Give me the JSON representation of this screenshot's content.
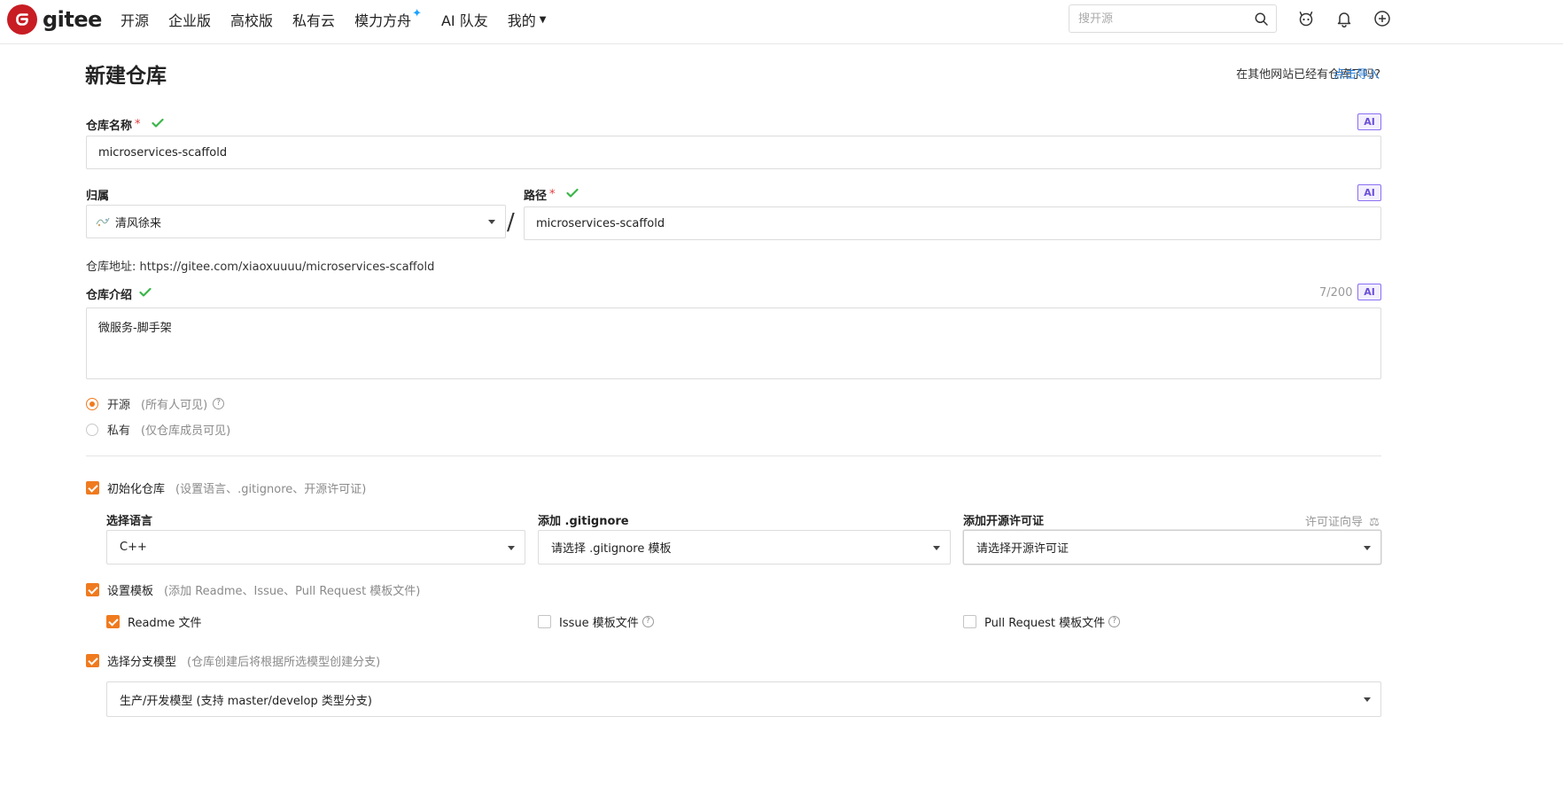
{
  "nav": {
    "brand": "gitee",
    "items": [
      "开源",
      "企业版",
      "高校版",
      "私有云",
      "模力方舟",
      "AI 队友",
      "我的"
    ],
    "search_placeholder": "搜开源"
  },
  "header": {
    "title": "新建仓库",
    "import_hint": "在其他网站已经有仓库了吗?",
    "import_link": "点击导入"
  },
  "form": {
    "repo_name_label": "仓库名称",
    "repo_name_value": "microservices-scaffold",
    "required_mark": "*",
    "ai_badge": "AI",
    "owner_label": "归属",
    "owner_value": "清风徐来",
    "path_label": "路径",
    "path_value": "microservices-scaffold",
    "slash": "/",
    "repo_url": "仓库地址: https://gitee.com/xiaoxuuuu/microservices-scaffold",
    "desc_label": "仓库介绍",
    "desc_counter": "7/200",
    "desc_value": "微服务-脚手架",
    "visibility": {
      "public_label": "开源",
      "public_hint": "(所有人可见)",
      "private_label": "私有",
      "private_hint": "(仅仓库成员可见)",
      "selected": "public"
    },
    "init_repo": {
      "label": "初始化仓库",
      "hint": "(设置语言、.gitignore、开源许可证)",
      "checked": true,
      "language_label": "选择语言",
      "language_value": "C++",
      "gitignore_label": "添加 .gitignore",
      "gitignore_value": "请选择 .gitignore 模板",
      "license_label": "添加开源许可证",
      "license_value": "请选择开源许可证",
      "license_guide": "许可证向导"
    },
    "templates": {
      "label": "设置模板",
      "hint": "(添加 Readme、Issue、Pull Request 模板文件)",
      "checked": true,
      "readme_label": "Readme 文件",
      "readme_checked": true,
      "issue_label": "Issue 模板文件",
      "issue_checked": false,
      "pr_label": "Pull Request 模板文件",
      "pr_checked": false
    },
    "branch_model": {
      "label": "选择分支模型",
      "hint": "(仓库创建后将根据所选模型创建分支)",
      "checked": true,
      "value": "生产/开发模型 (支持 master/develop 类型分支)"
    }
  },
  "colors": {
    "brand_red": "#c71d23",
    "accent_orange": "#f07a1e",
    "link_blue": "#2b7fd8",
    "check_green": "#3bb54a"
  }
}
